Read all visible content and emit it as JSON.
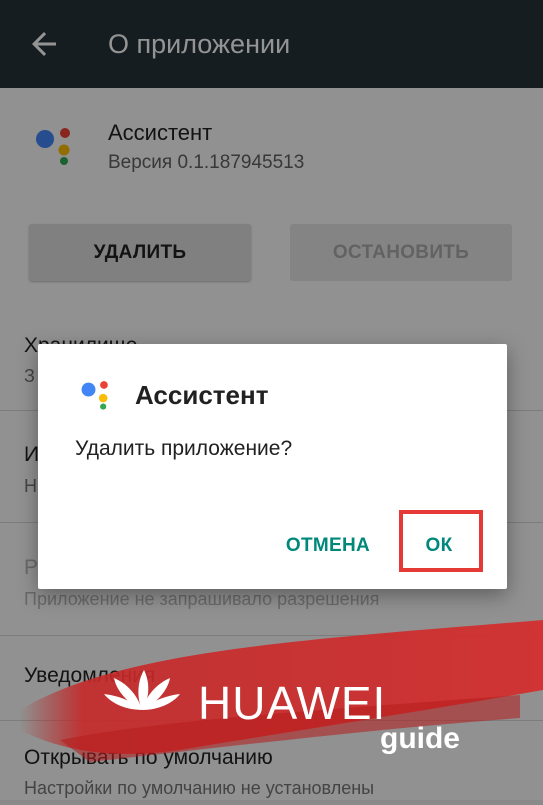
{
  "appbar": {
    "title": "О приложении",
    "back_icon": "arrow-back-icon"
  },
  "app": {
    "name": "Ассистент",
    "version": "Версия 0.1.187945513"
  },
  "buttons": {
    "delete": "УДАЛИТЬ",
    "stop": "ОСТАНОВИТЬ"
  },
  "rows": [
    {
      "title": "Хранилище",
      "subtitle": "З"
    },
    {
      "title": "И",
      "subtitle": "Н"
    },
    {
      "title": "Р",
      "subtitle": "Приложение не запрашивало разрешения"
    },
    {
      "title": "Уведомления",
      "subtitle": ""
    },
    {
      "title": "Открывать по умолчанию",
      "subtitle": "Настройки по умолчанию не установлены"
    }
  ],
  "dialog": {
    "title": "Ассистент",
    "message": "Удалить приложение?",
    "cancel": "ОТМЕНА",
    "ok": "ОК"
  },
  "watermark": {
    "brand": "HUAWEI",
    "tag": "guide"
  },
  "colors": {
    "appbar": "#263238",
    "accent_button_text": "#00897b",
    "highlight": "#e53935",
    "assistant_blue": "#4285F4",
    "assistant_red": "#EA4335",
    "assistant_yellow": "#FBBC05",
    "assistant_green": "#34A853"
  }
}
